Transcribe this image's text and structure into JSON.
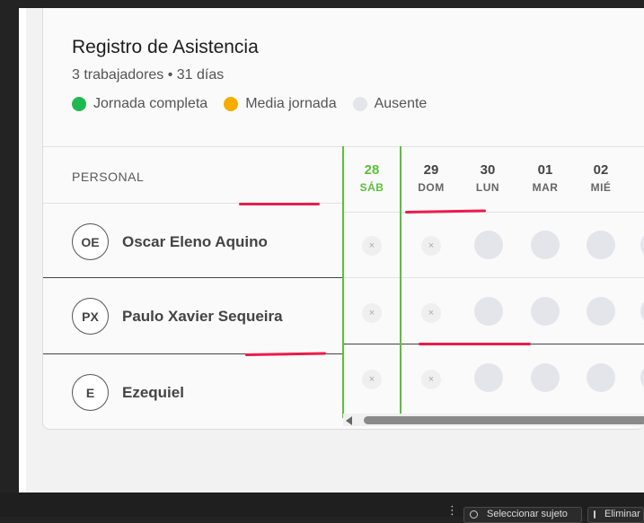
{
  "card": {
    "title": "Registro de Asistencia",
    "subtitle": "3 trabajadores • 31 días",
    "legend": [
      {
        "label": "Jornada completa",
        "color": "#1fba4f"
      },
      {
        "label": "Media jornada",
        "color": "#f5ad00"
      },
      {
        "label": "Ausente",
        "color": "#e3e5ea"
      }
    ]
  },
  "table": {
    "personal_header": "PERSONAL",
    "workers": [
      {
        "initials": "OE",
        "name": "Oscar Eleno Aquino"
      },
      {
        "initials": "PX",
        "name": "Paulo Xavier Sequeira"
      },
      {
        "initials": "E",
        "name": "Ezequiel"
      }
    ],
    "days": [
      {
        "num": "28",
        "wd": "SÁB",
        "today": true
      },
      {
        "num": "29",
        "wd": "DOM"
      },
      {
        "num": "30",
        "wd": "LUN"
      },
      {
        "num": "01",
        "wd": "MAR"
      },
      {
        "num": "02",
        "wd": "MIÉ"
      }
    ],
    "excluded_mark": "×"
  },
  "taskbar": {
    "buttons": [
      {
        "label": "Seleccionar sujeto",
        "icon": "target-icon"
      },
      {
        "label": "Eliminar",
        "icon": "image-icon"
      }
    ],
    "grip": "⋮"
  }
}
